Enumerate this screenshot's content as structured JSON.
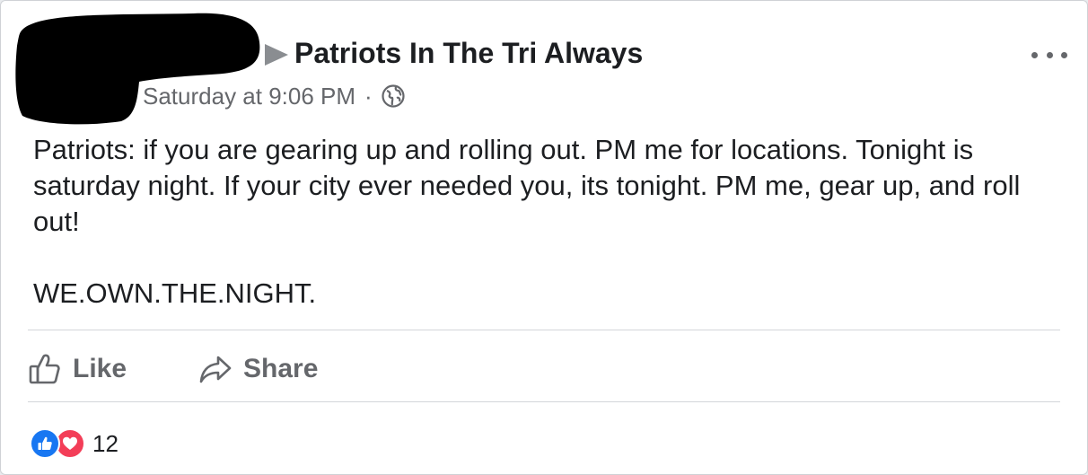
{
  "post": {
    "group_name": "Patriots In The Tri Always",
    "timestamp": "Saturday at 9:06 PM",
    "separator": "·",
    "privacy_icon": "globe-icon",
    "author_redacted": true,
    "body_paragraph_1": "Patriots: if you are gearing up and rolling out. PM me for locations. Tonight is saturday night. If your city ever needed you, its tonight. PM me, gear up, and roll out!",
    "body_paragraph_2": "WE.OWN.THE.NIGHT."
  },
  "actions": {
    "like_label": "Like",
    "share_label": "Share"
  },
  "reactions": {
    "icons": [
      "like-reaction-icon",
      "love-reaction-icon"
    ],
    "count": "12"
  },
  "colors": {
    "like_blue": "#1877f2",
    "love_red": "#f33e58",
    "secondary_text": "#65676b",
    "redaction": "#000000"
  }
}
